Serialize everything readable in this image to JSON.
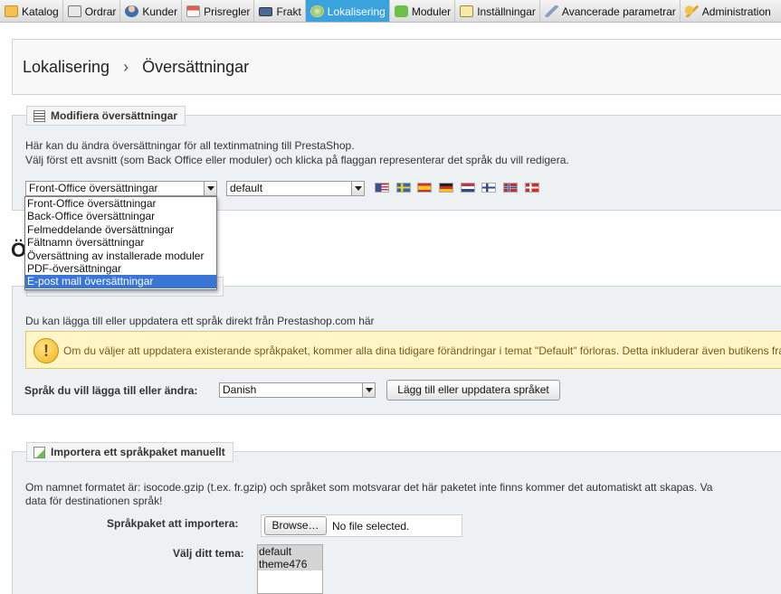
{
  "nav": {
    "tabs": [
      {
        "label": "Katalog",
        "icon": "folder-icon"
      },
      {
        "label": "Ordrar",
        "icon": "cart-icon"
      },
      {
        "label": "Kunder",
        "icon": "user-icon"
      },
      {
        "label": "Prisregler",
        "icon": "price-rules-icon"
      },
      {
        "label": "Frakt",
        "icon": "truck-icon"
      },
      {
        "label": "Lokalisering",
        "icon": "globe-icon"
      },
      {
        "label": "Moduler",
        "icon": "puzzle-icon"
      },
      {
        "label": "Inställningar",
        "icon": "settings-icon"
      },
      {
        "label": "Avancerade parametrar",
        "icon": "wrench-icon"
      },
      {
        "label": "Administration",
        "icon": "key-icon"
      }
    ],
    "active_index": 5
  },
  "breadcrumb": {
    "parent": "Lokalisering",
    "separator": "›",
    "current": "Översättningar"
  },
  "modify": {
    "legend": "Modifiera översättningar",
    "text1": "Här kan du ändra översättningar för all textinmatning till PrestaShop.",
    "text2": "Välj först ett avsnitt (som Back Office eller moduler) och klicka på flaggan representerar det språk du vill redigera.",
    "type_select_value": "Front-Office översättningar",
    "theme_select_value": "default",
    "type_options": [
      "Front-Office översättningar",
      "Back-Office översättningar",
      "Felmeddelande översättningar",
      "Fältnamn översättningar",
      "Översättning av installerade moduler",
      "PDF-översättningar",
      "E-post mall översättningar"
    ],
    "highlighted_option_index": 6,
    "flags": [
      "us-flag-icon",
      "se-flag-icon",
      "es-flag-icon",
      "de-flag-icon",
      "nl-flag-icon",
      "fi-flag-icon",
      "no-flag-icon",
      "dk-flag-icon"
    ]
  },
  "partial_heading": "Ö",
  "add_lang": {
    "text": "Du kan lägga till eller uppdatera ett språk direkt från Prestashop.com här",
    "warning": "Om du väljer att uppdatera existerande språkpaket, kommer alla dina tidigare förändringar i temat \"Default\" förloras. Detta inkluderar även butikens fra",
    "select_label": "Språk du vill lägga till eller ändra:",
    "select_value": "Danish",
    "button": "Lägg till eller uppdatera språket"
  },
  "import": {
    "legend": "Importera ett språkpaket manuellt",
    "text1": "Om namnet formatet är: isocode.gzip (t.ex. fr.gzip) och språket som motsvarar det här paketet inte finns kommer det automatiskt att skapas. Va",
    "text2": "data för destinationen språk!",
    "file_label": "Språkpaket att importera:",
    "browse_button": "Browse…",
    "file_status": "No file selected.",
    "theme_label": "Välj ditt tema:",
    "themes": [
      "default",
      "theme476"
    ]
  },
  "colors": {
    "active_tab": "#3aa2dc",
    "highlight": "#3875d7",
    "warning_bg": "#fff5c6"
  }
}
